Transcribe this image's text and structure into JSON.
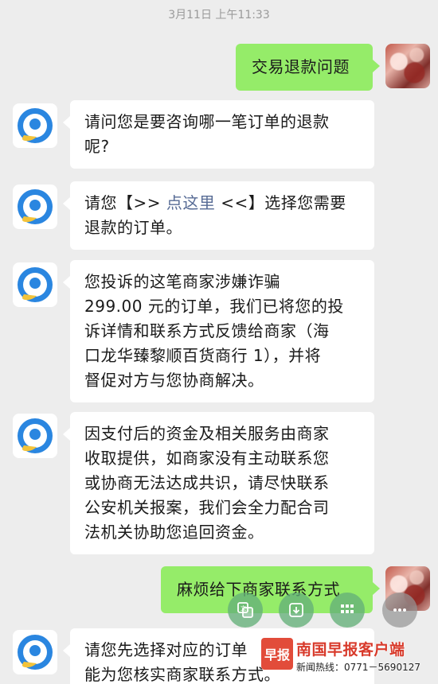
{
  "timestamp": "3月11日 上午11:33",
  "messages": {
    "m1": {
      "text": "交易退款问题"
    },
    "m2": {
      "line1": "请问您是要咨询哪一笔订单的退款",
      "line2": "呢?"
    },
    "m3": {
      "pre": "请您【>> ",
      "link": "点这里",
      "post": " <<】选择您需要",
      "line2": "退款的订单。"
    },
    "m4": {
      "line1": "您投诉的这笔商家涉嫌诈骗",
      "line2": "299.00 元的订单，我们已将您的投",
      "line3": "诉详情和联系方式反馈给商家（海",
      "line4": "口龙华臻黎顺百货商行 1），并将",
      "line5": "督促对方与您协商解决。"
    },
    "m5": {
      "line1": "因支付后的资金及相关服务由商家",
      "line2": "收取提供，如商家没有主动联系您",
      "line3": "或协商无法达成共识，请尽快联系",
      "line4": "公安机关报案，我们会全力配合司",
      "line5": "法机关协助您追回资金。"
    },
    "m6": {
      "text": "麻烦给下商家联系方式"
    },
    "m7": {
      "line1": "请您先选择对应的订单",
      "line2": "能为您核实商家联系方式。"
    }
  },
  "float_toolbar": [
    "translate-icon",
    "download-icon",
    "grid-icon",
    "more-icon"
  ],
  "watermark": {
    "logo": "早报",
    "title": "南国早报客户端",
    "hotline": "新闻热线：0771－5690127"
  },
  "colors": {
    "background": "#ededed",
    "user_bubble": "#95ec69",
    "bot_bubble": "#ffffff",
    "link": "#576b95",
    "brand_red": "#d83a2b"
  }
}
